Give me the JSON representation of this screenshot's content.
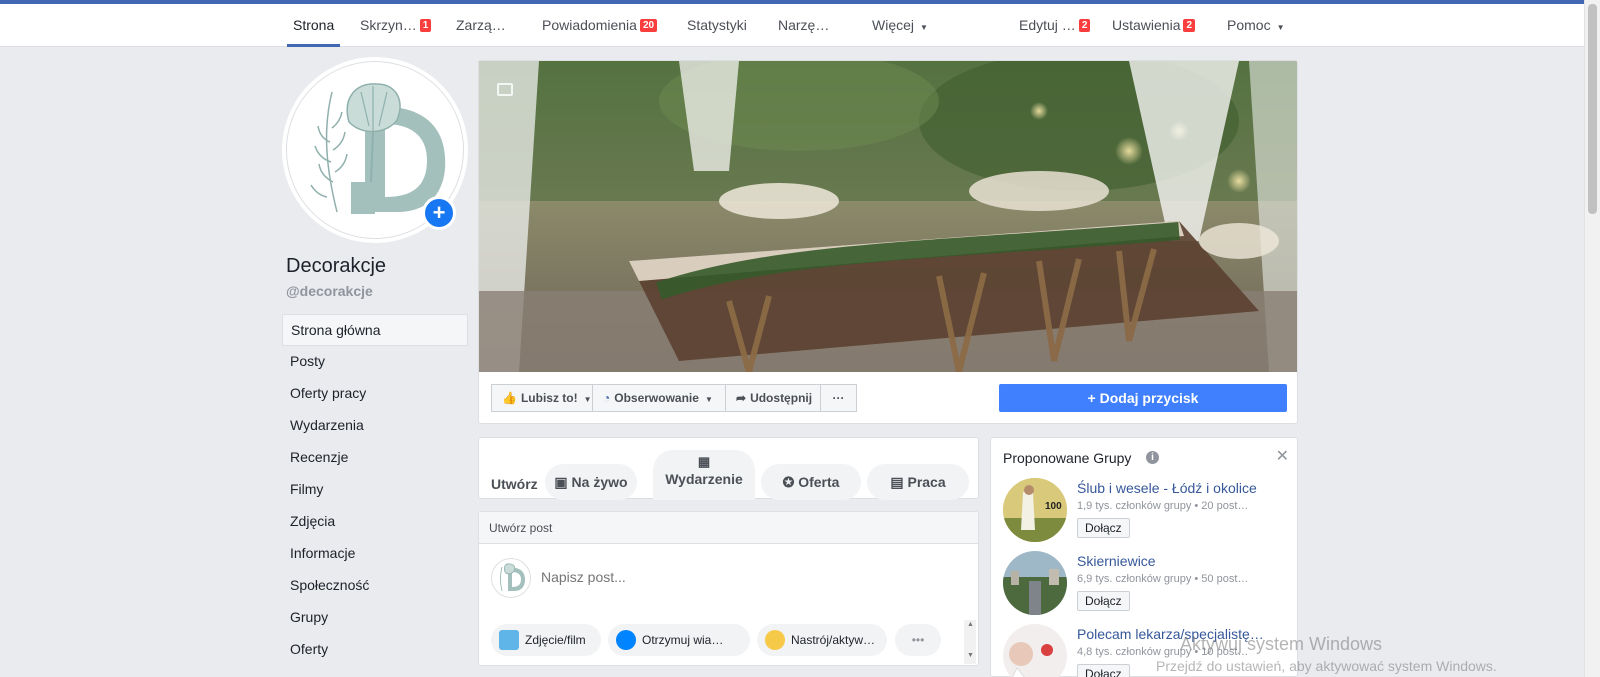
{
  "nav": {
    "items": [
      {
        "label": "Strona",
        "active": true
      },
      {
        "label": "Skrzyn…",
        "badge": "1"
      },
      {
        "label": "Zarzą…"
      },
      {
        "label": "Powiadomienia",
        "badge": "20"
      },
      {
        "label": "Statystyki"
      },
      {
        "label": "Narzę…"
      },
      {
        "label": "Więcej",
        "dropdown": true
      }
    ],
    "right": [
      {
        "label": "Edytuj …",
        "badge": "2"
      },
      {
        "label": "Ustawienia",
        "badge": "2"
      },
      {
        "label": "Pomoc",
        "dropdown": true
      }
    ]
  },
  "page": {
    "name": "Decorakcje",
    "handle": "@decorakcje",
    "avatar_letter": "D"
  },
  "leftnav": [
    "Strona główna",
    "Posty",
    "Oferty pracy",
    "Wydarzenia",
    "Recenzje",
    "Filmy",
    "Zdjęcia",
    "Informacje",
    "Społeczność",
    "Grupy",
    "Oferty"
  ],
  "actions": {
    "like": "Lubisz to!",
    "follow": "Obserwowanie",
    "share": "Udostępnij",
    "more": "···",
    "add_button": "Dodaj przycisk"
  },
  "create": {
    "label": "Utwórz",
    "live": "Na żywo",
    "event": "Wydarzenie",
    "offer": "Oferta",
    "job": "Praca"
  },
  "composer": {
    "header": "Utwórz post",
    "placeholder": "Napisz post...",
    "options": [
      "Zdjęcie/film",
      "Otrzymuj wia…",
      "Nastrój/aktyw…"
    ],
    "more": "•••"
  },
  "groups": {
    "title": "Proponowane Grupy",
    "join_label": "Dołącz",
    "items": [
      {
        "name": "Ślub i wesele - Łódź i okolice",
        "meta": "1,9 tys. członków grupy • 20 post…",
        "thumb_text": "100"
      },
      {
        "name": "Skierniewice",
        "meta": "6,9 tys. członków grupy • 50 post…"
      },
      {
        "name": "Polecam lekarza/specjalistę…",
        "meta": "4,8 tys. członków grupy • 10 post…"
      }
    ]
  },
  "watermark": {
    "line1": "Aktywuj system Windows",
    "line2": "Przejdź do ustawień, aby aktywować system Windows."
  },
  "colors": {
    "brand": "#4267b2",
    "primary_button": "#4080ff",
    "badge": "#fa3e3e",
    "link": "#365899"
  }
}
